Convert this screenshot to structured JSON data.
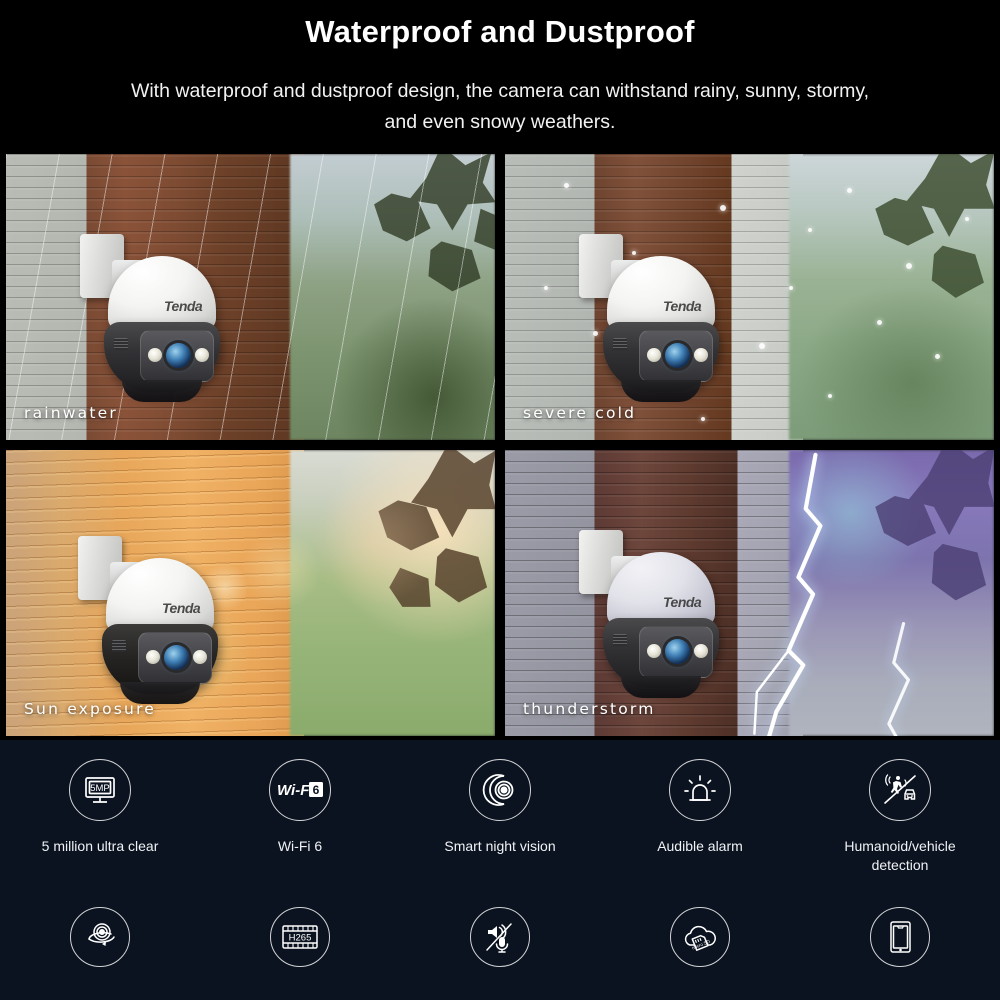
{
  "header": {
    "title": "Waterproof and Dustproof",
    "subtitle_line1": "With waterproof and dustproof design, the camera can withstand rainy, sunny, stormy,",
    "subtitle_line2": "and even snowy weathers."
  },
  "brand": "Tenda",
  "colors": {
    "header_bg": "#000000",
    "features_bg": "#0b1320",
    "text": "#ffffff",
    "icon_stroke": "#ffffff"
  },
  "gallery": [
    {
      "caption": "rainwater",
      "weather": "rain",
      "icon": "rain-icon"
    },
    {
      "caption": "severe cold",
      "weather": "snow",
      "icon": "snow-icon"
    },
    {
      "caption": "Sun exposure",
      "weather": "sun",
      "icon": "sun-icon"
    },
    {
      "caption": "thunderstorm",
      "weather": "thunderstorm",
      "icon": "lightning-icon"
    }
  ],
  "features": {
    "row1": [
      {
        "label": "5 million ultra clear",
        "icon": "monitor-5mp-icon",
        "badge": "5MP"
      },
      {
        "label": "Wi-Fi 6",
        "icon": "wifi-6-icon",
        "badge": "Wi-Fi 6"
      },
      {
        "label": "Smart night vision",
        "icon": "night-vision-icon",
        "badge": ""
      },
      {
        "label": "Audible alarm",
        "icon": "siren-alarm-icon",
        "badge": ""
      },
      {
        "label": "Humanoid/vehicle\ndetection",
        "icon": "human-vehicle-detection-icon",
        "badge": ""
      }
    ],
    "row2": [
      {
        "label": "",
        "icon": "pan-tilt-rotation-icon",
        "badge": ""
      },
      {
        "label": "",
        "icon": "h265-codec-icon",
        "badge": "H265"
      },
      {
        "label": "",
        "icon": "two-way-audio-icon",
        "badge": ""
      },
      {
        "label": "",
        "icon": "cloud-microsd-icon",
        "badge": ""
      },
      {
        "label": "",
        "icon": "mobile-app-icon",
        "badge": ""
      }
    ]
  }
}
